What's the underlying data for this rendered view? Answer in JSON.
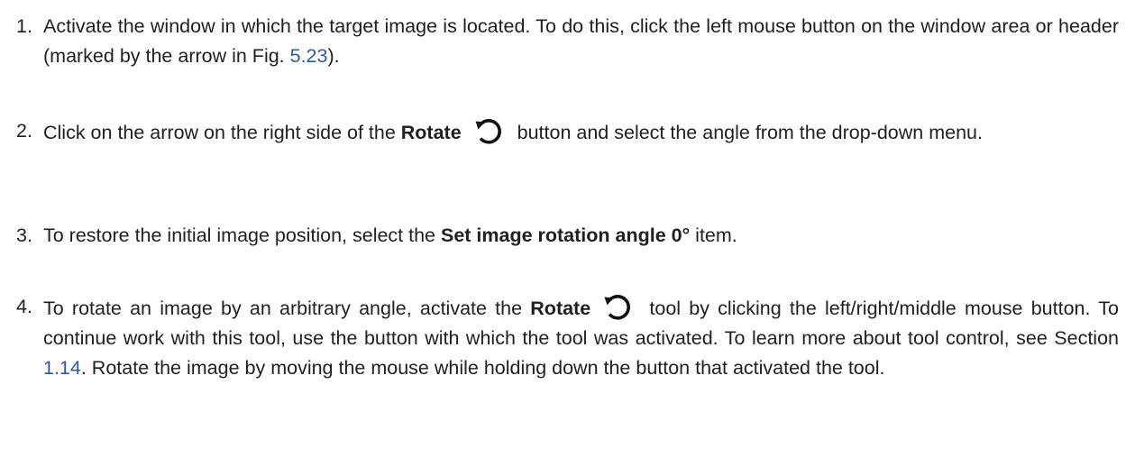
{
  "steps": [
    {
      "number": "1.",
      "text_1": "Activate the window in which the target image is located. To do this, click the left mouse button on the window area or header (marked by the arrow in Fig. ",
      "link": "5.23",
      "text_2": ")."
    },
    {
      "number": "2.",
      "text_1": "Click on the arrow on the right side of the ",
      "bold": "Rotate",
      "icon": "rotate-ccw-icon",
      "text_2": " button and select the angle from the drop-down menu."
    },
    {
      "number": "3.",
      "text_1": "To restore the initial image position, select the ",
      "bold": "Set image rotation angle 0°",
      "text_2": " item."
    },
    {
      "number": "4.",
      "text_1": "To rotate an image by an arbitrary angle, activate the ",
      "bold": "Rotate",
      "icon": "rotate-ccw-icon",
      "text_2": " tool by clicking the left/right/middle mouse button. To continue work with this tool, use the button with which the tool was activated. To learn more about tool control, see Section ",
      "link": "1.14",
      "text_3": ". Rotate the image by moving the mouse while holding down the button that activated the tool."
    }
  ],
  "colors": {
    "text": "#1f1f1f",
    "link": "#2b5aab"
  }
}
